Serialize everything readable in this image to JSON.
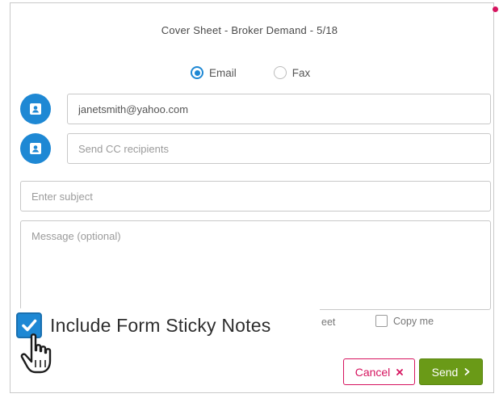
{
  "dialog": {
    "title": "Cover Sheet - Broker Demand - 5/18"
  },
  "send_method": {
    "options": [
      {
        "label": "Email",
        "selected": true
      },
      {
        "label": "Fax",
        "selected": false
      }
    ]
  },
  "recipients": {
    "to_value": "janetsmith@yahoo.com",
    "cc_placeholder": "Send CC recipients",
    "contact_icon": "address-book-icon"
  },
  "subject": {
    "placeholder": "Enter subject"
  },
  "message": {
    "placeholder": "Message (optional)"
  },
  "options": {
    "partially_hidden_label": "eet",
    "copy_me_label": "Copy me",
    "copy_me_checked": false
  },
  "callout": {
    "label": "Include Form Sticky Notes",
    "checked": true,
    "pointer_icon": "hand-pointer-icon"
  },
  "actions": {
    "cancel_label": "Cancel",
    "cancel_icon": "close-icon",
    "send_label": "Send",
    "send_icon": "chevron-right-icon"
  },
  "colors": {
    "accent": "#1e88d4",
    "cancel": "#d6145f",
    "send": "#6a9a17"
  }
}
